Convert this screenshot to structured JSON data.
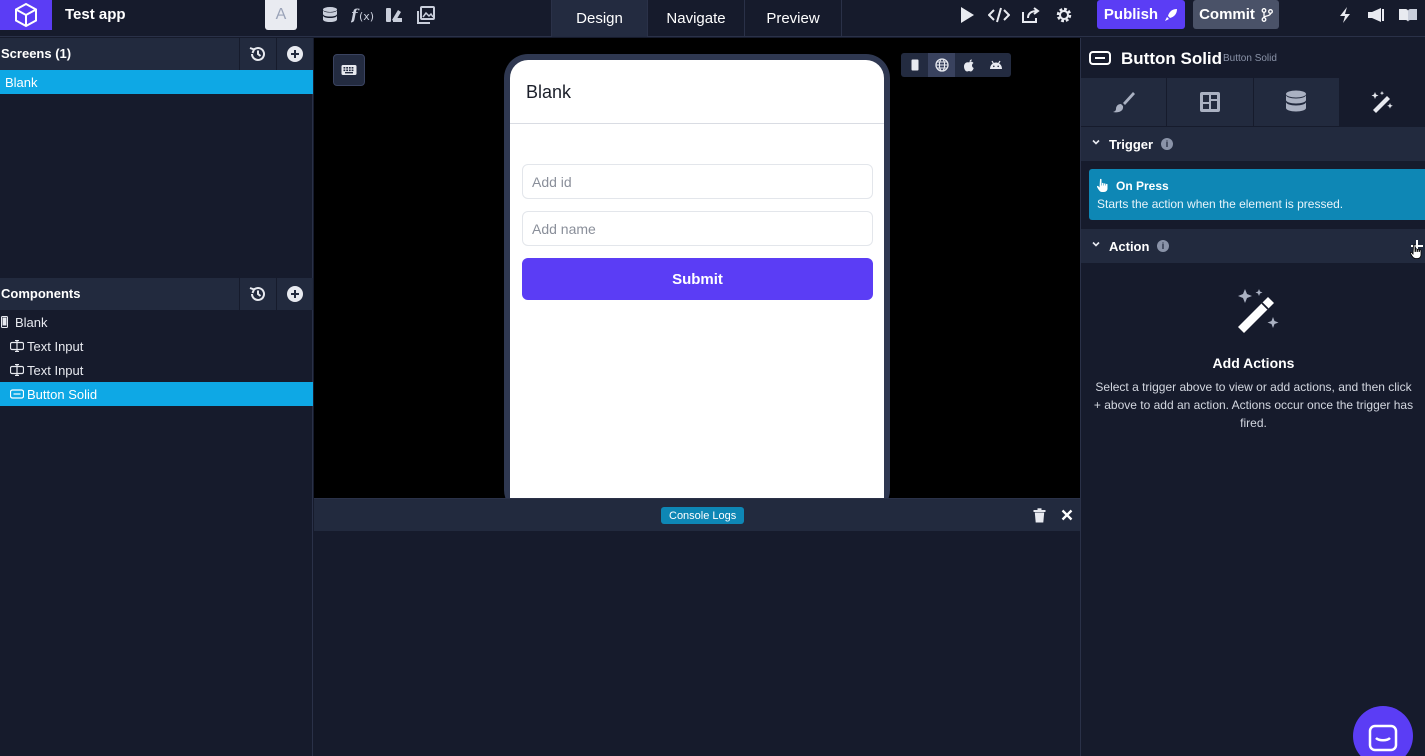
{
  "app": {
    "name": "Test app",
    "avatar_letter": "A"
  },
  "toolbar_icons": [
    "database-icon",
    "function-icon",
    "theme-icon",
    "image-icon"
  ],
  "tabs": [
    {
      "label": "Design",
      "active": true
    },
    {
      "label": "Navigate",
      "active": false
    },
    {
      "label": "Preview",
      "active": false
    }
  ],
  "actions": {
    "publish_label": "Publish",
    "commit_label": "Commit"
  },
  "left": {
    "screens_title": "Screens (1)",
    "screens": [
      {
        "label": "Blank",
        "selected": true
      }
    ],
    "components_title": "Components",
    "components": [
      {
        "label": "Blank",
        "icon": "screen-icon",
        "selected": false,
        "indent": 0
      },
      {
        "label": "Text Input",
        "icon": "text-input-icon",
        "selected": false,
        "indent": 1
      },
      {
        "label": "Text Input",
        "icon": "text-input-icon",
        "selected": false,
        "indent": 1
      },
      {
        "label": "Button Solid",
        "icon": "button-icon",
        "selected": true,
        "indent": 1
      }
    ]
  },
  "preview": {
    "screen_title": "Blank",
    "input1_placeholder": "Add id",
    "input2_placeholder": "Add name",
    "submit_label": "Submit",
    "platforms": [
      "mobile",
      "web",
      "ios",
      "android"
    ],
    "active_platform": "web"
  },
  "console": {
    "label": "Console Logs"
  },
  "right": {
    "component_title": "Button Solid",
    "component_subtitle": "Button Solid",
    "panel_tabs": [
      "style-icon",
      "layout-icon",
      "data-icon",
      "actions-icon"
    ],
    "active_panel_tab": "actions-icon",
    "trigger_section": "Trigger",
    "trigger_name": "On Press",
    "trigger_desc": "Starts the action when the element is pressed.",
    "action_section": "Action",
    "empty_title": "Add Actions",
    "empty_desc": "Select a trigger above to view or add actions, and then click + above to add an action. Actions occur once the trigger has fired."
  },
  "colors": {
    "brand": "#5b3df5",
    "selection": "#0ea8e5",
    "trigger": "#0e87b5",
    "background": "#161b2c"
  }
}
